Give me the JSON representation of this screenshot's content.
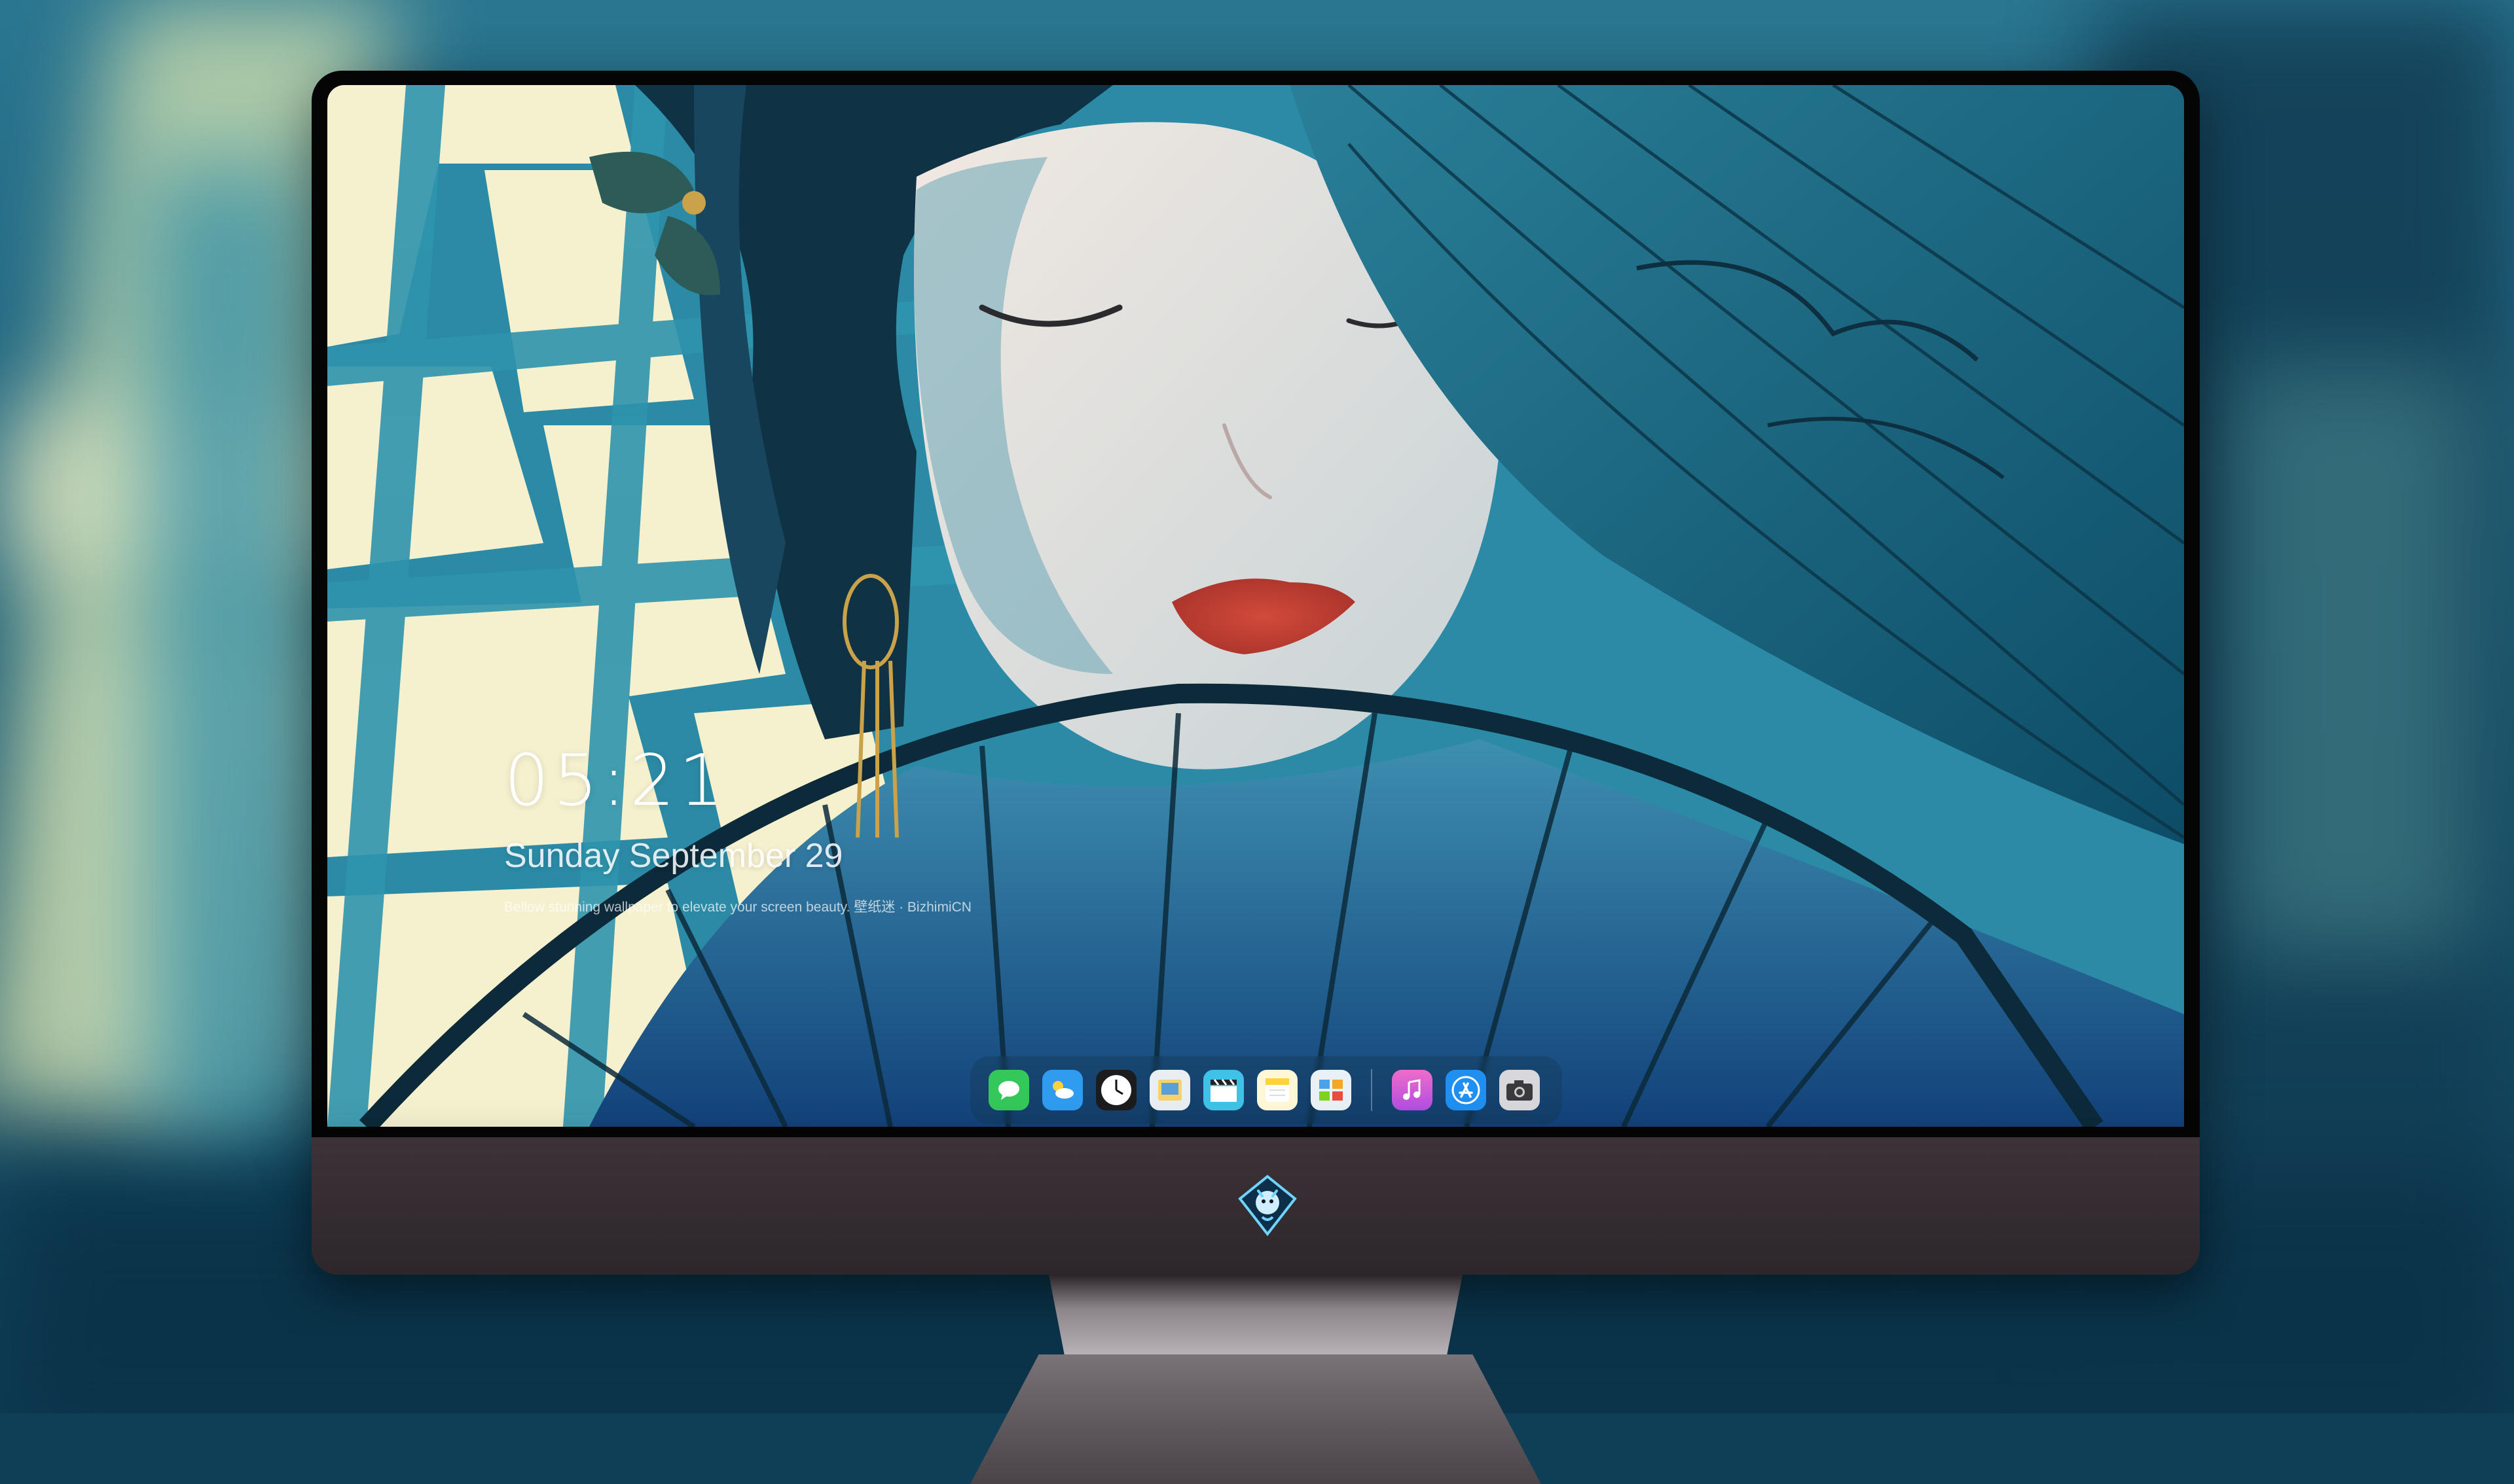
{
  "lock_screen": {
    "time": "05:21",
    "date": "Sunday September 29",
    "caption": "Bellow stunning wallpaper to elevate your screen beauty. 壁纸迷 · BizhimiCN"
  },
  "dock": {
    "apps": [
      {
        "name": "Messages",
        "icon": "messages-icon",
        "color": "#34c759"
      },
      {
        "name": "Weather",
        "icon": "weather-icon",
        "color": "#2f9cf0"
      },
      {
        "name": "Clock",
        "icon": "clock-icon",
        "color": "#1c1c1e"
      },
      {
        "name": "Preview",
        "icon": "preview-icon",
        "color": "#f5d26b"
      },
      {
        "name": "Video",
        "icon": "video-clapper-icon",
        "color": "#3ec3e6"
      },
      {
        "name": "Notes",
        "icon": "notes-icon",
        "color": "#ffd23a"
      },
      {
        "name": "Photos",
        "icon": "photos-icon",
        "color": "#e9f1f6"
      },
      {
        "name": "Music",
        "icon": "music-icon",
        "color": "#e35bd9"
      },
      {
        "name": "App Store",
        "icon": "app-store-icon",
        "color": "#1f8ff2"
      },
      {
        "name": "Camera",
        "icon": "camera-icon",
        "color": "#9a9a9e"
      }
    ]
  },
  "monitor": {
    "logo_icon": "dragon-mascot-icon",
    "frame_color": "#050505",
    "chin_color": "#352d31"
  }
}
